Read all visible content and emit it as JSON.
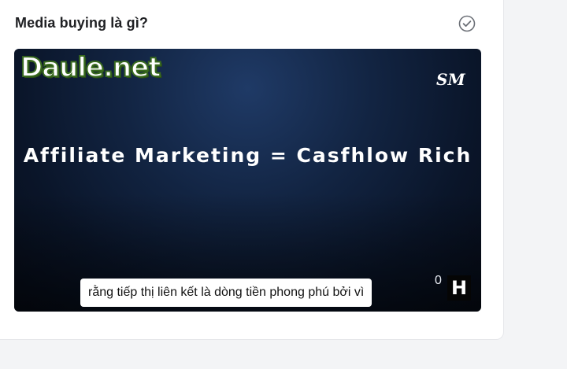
{
  "lesson": {
    "title": "Media buying là gì?"
  },
  "video": {
    "watermark": "Daule.net",
    "brand_logo_text": "SM",
    "brand_logo_icon": "sm-logo-icon",
    "headline": "Affiliate Marketing = Casfhlow Rich",
    "subtitle": "rằng tiếp thị liên kết là dòng tiền phong phú bởi vì",
    "corner_zero": "0",
    "corner_badge": "H"
  },
  "icons": {
    "complete": "check-circle-icon"
  },
  "colors": {
    "card_bg": "#ffffff",
    "page_bg": "#f3f4f6",
    "video_bg": "#0f203d",
    "watermark_outline": "#3a6b1f",
    "icon_gray": "#6b6f76"
  }
}
